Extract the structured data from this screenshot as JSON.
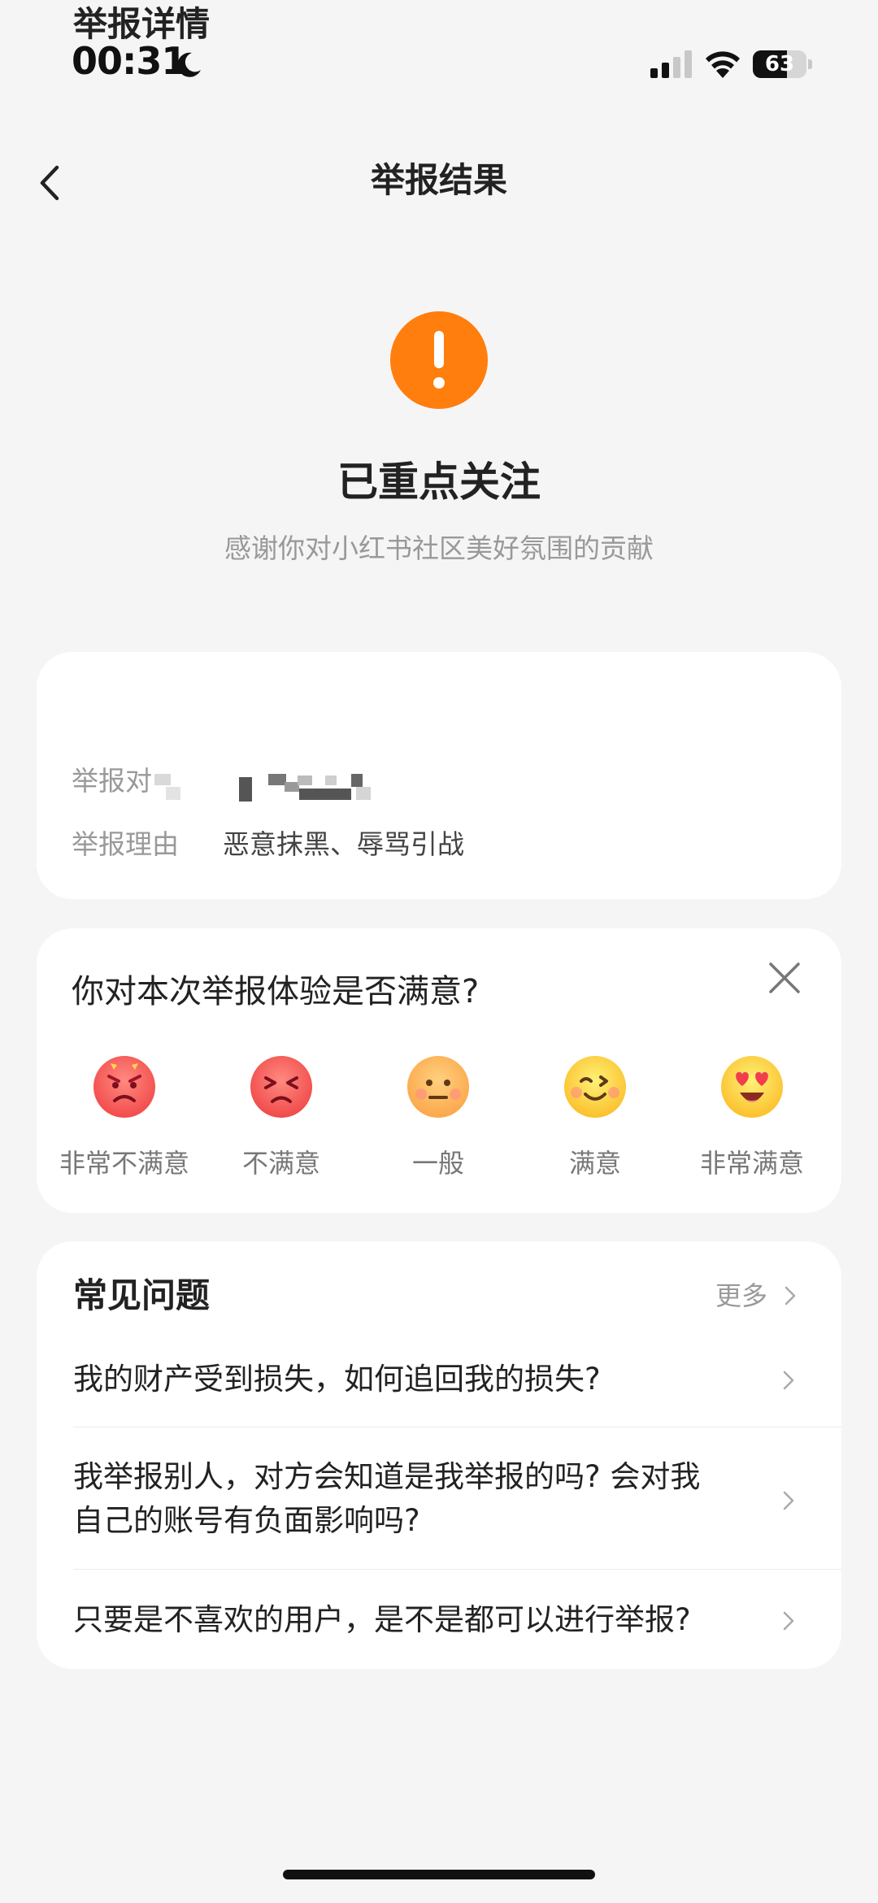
{
  "status_bar": {
    "time": "00:31",
    "battery_percent": 63,
    "battery_label": "63"
  },
  "nav": {
    "title": "举报结果"
  },
  "result": {
    "title": "已重点关注",
    "subtitle": "感谢你对小红书社区美好氛围的贡献",
    "icon": "exclamation-icon",
    "icon_color": "#ff7e0d"
  },
  "report_detail": {
    "title": "举报详情",
    "target_label": "举报对",
    "reason_label": "举报理由",
    "reason_value": "恶意抹黑、辱骂引战"
  },
  "survey": {
    "question": "你对本次举报体验是否满意?",
    "options": [
      {
        "label": "非常不满意",
        "icon": "very-dissatisfied-emoji"
      },
      {
        "label": "不满意",
        "icon": "dissatisfied-emoji"
      },
      {
        "label": "一般",
        "icon": "neutral-emoji"
      },
      {
        "label": "满意",
        "icon": "satisfied-emoji"
      },
      {
        "label": "非常满意",
        "icon": "very-satisfied-emoji"
      }
    ]
  },
  "faq": {
    "title": "常见问题",
    "more_label": "更多",
    "items": [
      {
        "line1": "我的财产受到损失，如何追回我的损失?",
        "line2": ""
      },
      {
        "line1": "我举报别人，对方会知道是我举报的吗? 会对我",
        "line2": "自己的账号有负面影响吗?"
      },
      {
        "line1": "只要是不喜欢的用户，是不是都可以进行举报?",
        "line2": ""
      }
    ]
  },
  "colors": {
    "background": "#f5f5f5",
    "card": "#ffffff",
    "accent_orange": "#ff7e0d",
    "secondary_text": "#999999"
  }
}
